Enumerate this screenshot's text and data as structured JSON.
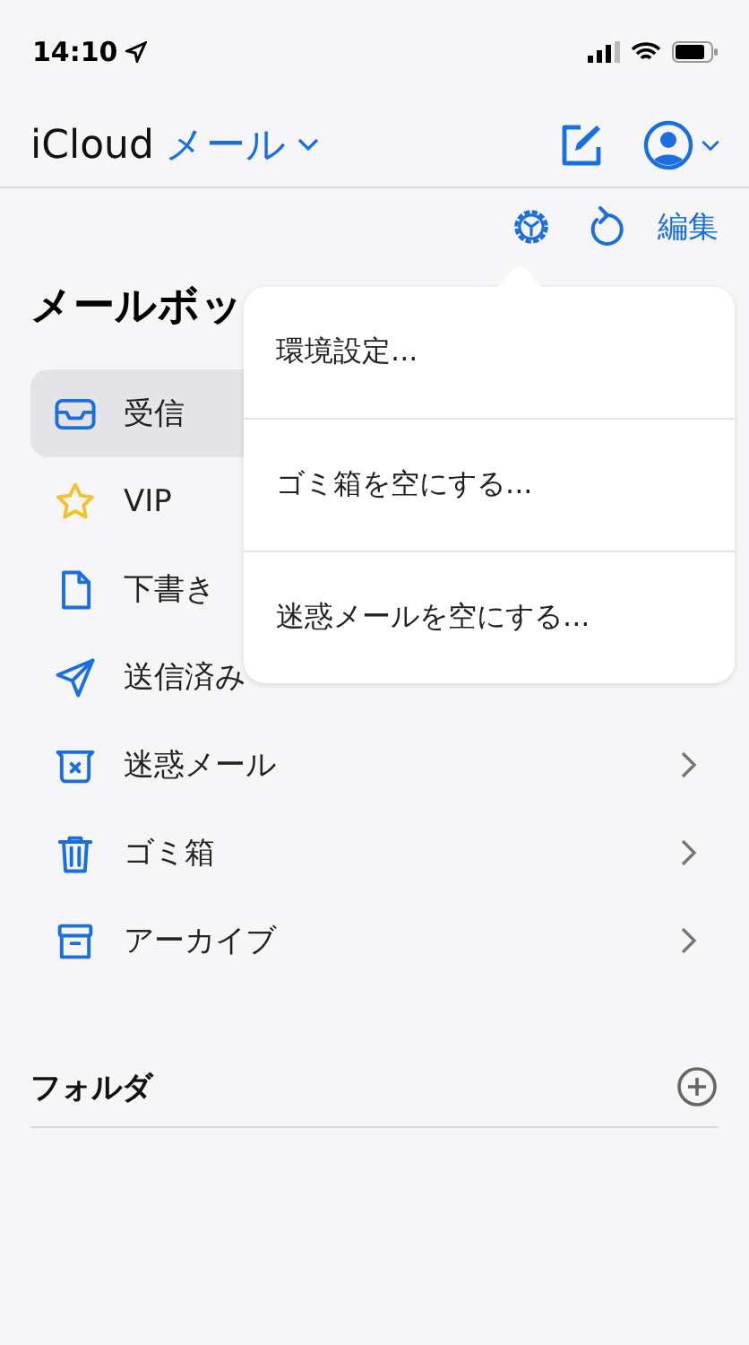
{
  "status_bar": {
    "time": "14:10"
  },
  "nav": {
    "prefix": "iCloud",
    "title": "メール"
  },
  "toolbar": {
    "edit": "編集"
  },
  "heading": "メールボッ",
  "mailboxes": [
    {
      "label": "受信",
      "kind": "inbox",
      "selected": true
    },
    {
      "label": "VIP",
      "kind": "star",
      "selected": false
    },
    {
      "label": "下書き",
      "kind": "doc",
      "selected": false
    },
    {
      "label": "送信済み",
      "kind": "send",
      "selected": false
    },
    {
      "label": "迷惑メール",
      "kind": "junk",
      "selected": false,
      "chevron": true
    },
    {
      "label": "ゴミ箱",
      "kind": "trash",
      "selected": false,
      "chevron": true
    },
    {
      "label": "アーカイブ",
      "kind": "archive",
      "selected": false,
      "chevron": true
    }
  ],
  "folders": {
    "title": "フォルダ"
  },
  "menu": {
    "items": [
      "環境設定...",
      "ゴミ箱を空にする...",
      "迷惑メールを空にする..."
    ]
  }
}
